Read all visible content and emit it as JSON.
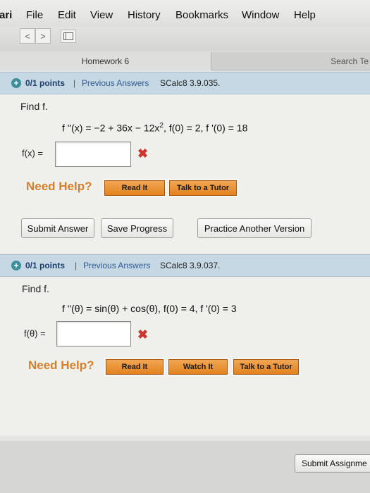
{
  "menubar": {
    "app": "ari",
    "items": [
      "File",
      "Edit",
      "View",
      "History",
      "Bookmarks",
      "Window",
      "Help"
    ]
  },
  "toolbar": {
    "back_glyph": "<",
    "forward_glyph": ">",
    "sidebar_icon": "sidebar-icon"
  },
  "tabs": {
    "active": "Homework 6",
    "other": "Search Te"
  },
  "questions": [
    {
      "points": "0/1 points",
      "separator": "|",
      "previous": "Previous Answers",
      "source": "SCalc8 3.9.035.",
      "prompt": "Find f.",
      "equation": "f ''(x) = −2 + 36x − 12x², f(0) = 2, f '(0) = 18",
      "eq_parts": {
        "a": "f ''(x) = −2 + 36x − 12x",
        "sup": "2",
        "b": ",     f(0) = 2,     f '(0) = 18"
      },
      "answer_label": "f(x) =",
      "answer_value": "",
      "status": "✖",
      "need_help": "Need Help?",
      "help_buttons": [
        "Read It",
        "Talk to a Tutor"
      ],
      "actions": [
        "Submit Answer",
        "Save Progress",
        "Practice Another Version"
      ]
    },
    {
      "points": "0/1 points",
      "separator": "|",
      "previous": "Previous Answers",
      "source": "SCalc8 3.9.037.",
      "prompt": "Find f.",
      "equation": "f ''(θ) = sin(θ) + cos(θ),     f(0) = 4,     f '(0) = 3",
      "answer_label": "f(θ) =",
      "answer_value": "",
      "status": "✖",
      "need_help": "Need Help?",
      "help_buttons": [
        "Read It",
        "Watch It",
        "Talk to a Tutor"
      ]
    }
  ],
  "footer": {
    "submit_assignment": "Submit Assignme"
  },
  "colors": {
    "question_header": "#c5d8e4",
    "need_help": "#d4802a",
    "help_button": "#e2821e",
    "error": "#d0342c",
    "link": "#2e5a93"
  }
}
